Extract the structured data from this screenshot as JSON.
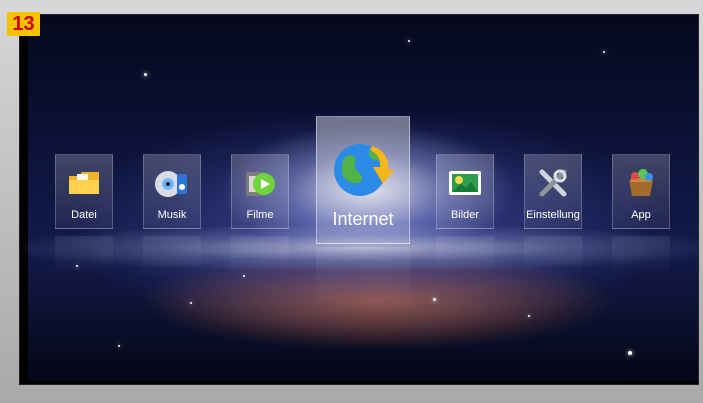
{
  "step_badge": "13",
  "menu": {
    "items": [
      {
        "label": "Datei",
        "icon": "folder-icon"
      },
      {
        "label": "Musik",
        "icon": "music-icon"
      },
      {
        "label": "Filme",
        "icon": "film-icon"
      },
      {
        "label": "Internet",
        "icon": "globe-icon",
        "selected": true
      },
      {
        "label": "Bilder",
        "icon": "picture-icon"
      },
      {
        "label": "Einstellung",
        "icon": "settings-tools-icon"
      },
      {
        "label": "App",
        "icon": "app-box-icon"
      }
    ]
  }
}
